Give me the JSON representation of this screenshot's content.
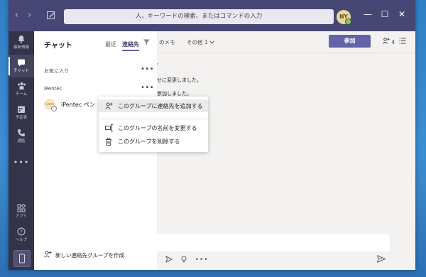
{
  "titlebar": {
    "search_placeholder": "人、キーワードの検索、またはコマンドの入力",
    "avatar_initials": "NY",
    "back_glyph": "‹",
    "forward_glyph": "›",
    "minimize_glyph": "—",
    "maximize_glyph": "☐",
    "close_glyph": "✕"
  },
  "appbar": {
    "items": [
      {
        "label": "最新情報",
        "icon": "bell-icon"
      },
      {
        "label": "チャット",
        "icon": "chat-icon"
      },
      {
        "label": "チーム",
        "icon": "teams-icon"
      },
      {
        "label": "予定表",
        "icon": "calendar-icon"
      },
      {
        "label": "通話",
        "icon": "phone-icon"
      }
    ],
    "more": "•••",
    "bottom": [
      {
        "label": "アプリ",
        "icon": "apps-icon"
      },
      {
        "label": "ヘルプ",
        "icon": "help-icon"
      }
    ]
  },
  "leftpane": {
    "title": "チャット",
    "tab_recent": "最近",
    "tab_contacts": "連絡先",
    "section_favorites": "お気に入り",
    "section_group": "iPentec",
    "more_glyph": "•••",
    "contact_name": "iPentec ペン",
    "contact_avatar_text": "i-pen",
    "new_group": "新しい連絡先グループを作成"
  },
  "main": {
    "tab_notes": "のメモ",
    "tab_other": "その他 1",
    "join_label": "参加",
    "people_count": "4",
    "messages": [
      "'",
      "せに変更しました。",
      "参加しました。"
    ],
    "toolbar_more": "•••"
  },
  "context_menu": {
    "items": [
      {
        "label": "このグループに連絡先を追加する",
        "icon": "add-person-icon"
      },
      {
        "label": "このグループの名前を変更する",
        "icon": "rename-icon"
      },
      {
        "label": "このグループを削除する",
        "icon": "trash-icon"
      }
    ]
  },
  "colors": {
    "titlebar": "#464775",
    "appbar": "#33344a",
    "accent": "#6264a7",
    "avatar_bg": "#e6d79a",
    "presence": "#92c353"
  }
}
